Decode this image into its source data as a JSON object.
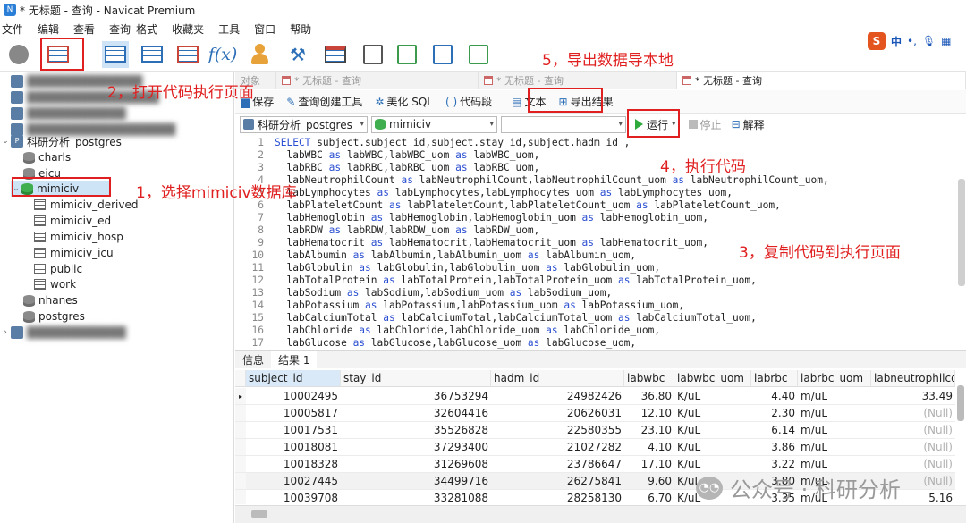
{
  "window": {
    "title": "* 无标题 - 查询 - Navicat Premium"
  },
  "menu": [
    "文件",
    "编辑",
    "查看",
    "查询",
    "格式",
    "收藏夹",
    "工具",
    "窗口",
    "帮助"
  ],
  "toolbar": {
    "object_label": "对象"
  },
  "ime": {
    "brand": "S",
    "lang": "中",
    "punct": "•,",
    "mic": "🎙",
    "grid": "▦"
  },
  "sidebar": {
    "connection": "科研分析_postgres",
    "databases": [
      "charls",
      "eicu",
      "mimiciv",
      "nhanes",
      "postgres"
    ],
    "selected_db": "mimiciv",
    "schemas": [
      "mimiciv_derived",
      "mimiciv_ed",
      "mimiciv_hosp",
      "mimiciv_icu",
      "public",
      "work"
    ]
  },
  "tabs": [
    "* 无标题 - 查询",
    "* 无标题 - 查询",
    "* 无标题 - 查询"
  ],
  "query_toolbar": {
    "save": "保存",
    "builder": "查询创建工具",
    "beautify": "美化 SQL",
    "snippet": "代码段",
    "text": "文本",
    "export": "导出结果"
  },
  "selectors": {
    "connection": "科研分析_postgres",
    "database": "mimiciv",
    "run": "运行",
    "stop": "停止",
    "explain": "解释"
  },
  "sql_lines": [
    {
      "n": "1",
      "pre": "",
      "kw1": "SELECT",
      "mid": " subject.subject_id,subject.stay_id,subject.hadm_id ,",
      "kw2": "",
      "post": ""
    },
    {
      "n": "2",
      "pre": "  labWBC ",
      "kw1": "as",
      "mid": " labWBC,labWBC_uom ",
      "kw2": "as",
      "post": " labWBC_uom,"
    },
    {
      "n": "3",
      "pre": "  labRBC ",
      "kw1": "as",
      "mid": " labRBC,labRBC_uom ",
      "kw2": "as",
      "post": " labRBC_uom,"
    },
    {
      "n": "4",
      "pre": "  labNeutrophilCount ",
      "kw1": "as",
      "mid": " labNeutrophilCount,labNeutrophilCount_uom ",
      "kw2": "as",
      "post": " labNeutrophilCount_uom,"
    },
    {
      "n": "5",
      "pre": "  labLymphocytes ",
      "kw1": "as",
      "mid": " labLymphocytes,labLymphocytes_uom ",
      "kw2": "as",
      "post": " labLymphocytes_uom,"
    },
    {
      "n": "6",
      "pre": "  labPlateletCount ",
      "kw1": "as",
      "mid": " labPlateletCount,labPlateletCount_uom ",
      "kw2": "as",
      "post": " labPlateletCount_uom,"
    },
    {
      "n": "7",
      "pre": "  labHemoglobin ",
      "kw1": "as",
      "mid": " labHemoglobin,labHemoglobin_uom ",
      "kw2": "as",
      "post": " labHemoglobin_uom,"
    },
    {
      "n": "8",
      "pre": "  labRDW ",
      "kw1": "as",
      "mid": " labRDW,labRDW_uom ",
      "kw2": "as",
      "post": " labRDW_uom,"
    },
    {
      "n": "9",
      "pre": "  labHematocrit ",
      "kw1": "as",
      "mid": " labHematocrit,labHematocrit_uom ",
      "kw2": "as",
      "post": " labHematocrit_uom,"
    },
    {
      "n": "10",
      "pre": "  labAlbumin ",
      "kw1": "as",
      "mid": " labAlbumin,labAlbumin_uom ",
      "kw2": "as",
      "post": " labAlbumin_uom,"
    },
    {
      "n": "11",
      "pre": "  labGlobulin ",
      "kw1": "as",
      "mid": " labGlobulin,labGlobulin_uom ",
      "kw2": "as",
      "post": " labGlobulin_uom,"
    },
    {
      "n": "12",
      "pre": "  labTotalProtein ",
      "kw1": "as",
      "mid": " labTotalProtein,labTotalProtein_uom ",
      "kw2": "as",
      "post": " labTotalProtein_uom,"
    },
    {
      "n": "13",
      "pre": "  labSodium ",
      "kw1": "as",
      "mid": " labSodium,labSodium_uom ",
      "kw2": "as",
      "post": " labSodium_uom,"
    },
    {
      "n": "14",
      "pre": "  labPotassium ",
      "kw1": "as",
      "mid": " labPotassium,labPotassium_uom ",
      "kw2": "as",
      "post": " labPotassium_uom,"
    },
    {
      "n": "15",
      "pre": "  labCalciumTotal ",
      "kw1": "as",
      "mid": " labCalciumTotal,labCalciumTotal_uom ",
      "kw2": "as",
      "post": " labCalciumTotal_uom,"
    },
    {
      "n": "16",
      "pre": "  labChloride ",
      "kw1": "as",
      "mid": " labChloride,labChloride_uom ",
      "kw2": "as",
      "post": " labChloride_uom,"
    },
    {
      "n": "17",
      "pre": "  labGlucose ",
      "kw1": "as",
      "mid": " labGlucose,labGlucose_uom ",
      "kw2": "as",
      "post": " labGlucose_uom,"
    }
  ],
  "result_tabs": [
    "信息",
    "结果 1"
  ],
  "grid": {
    "columns": [
      "subject_id",
      "stay_id",
      "hadm_id",
      "labwbc",
      "labwbc_uom",
      "labrbc",
      "labrbc_uom",
      "labneutrophilcou"
    ],
    "rows": [
      [
        "10002495",
        "36753294",
        "24982426",
        "36.80",
        "K/uL",
        "4.40",
        "m/uL",
        "33.49"
      ],
      [
        "10005817",
        "32604416",
        "20626031",
        "12.10",
        "K/uL",
        "2.30",
        "m/uL",
        "(Null)"
      ],
      [
        "10017531",
        "35526828",
        "22580355",
        "23.10",
        "K/uL",
        "6.14",
        "m/uL",
        "(Null)"
      ],
      [
        "10018081",
        "37293400",
        "21027282",
        "4.10",
        "K/uL",
        "3.86",
        "m/uL",
        "(Null)"
      ],
      [
        "10018328",
        "31269608",
        "23786647",
        "17.10",
        "K/uL",
        "3.22",
        "m/uL",
        "(Null)"
      ],
      [
        "10027445",
        "34499716",
        "26275841",
        "9.60",
        "K/uL",
        "3.80",
        "m/uL",
        "(Null)"
      ],
      [
        "10039708",
        "33281088",
        "28258130",
        "6.70",
        "K/uL",
        "3.35",
        "m/uL",
        "5.16"
      ]
    ]
  },
  "annotations": [
    "1，选择mimiciv数据库",
    "2，打开代码执行页面",
    "3，复制代码到执行页面",
    "4，执行代码",
    "5，导出数据导本地"
  ],
  "watermark": "公众号 · 科研分析",
  "colors": {
    "annotation": "#e02020",
    "selection": "#cde4f7",
    "keyword": "#2b4fd1"
  }
}
